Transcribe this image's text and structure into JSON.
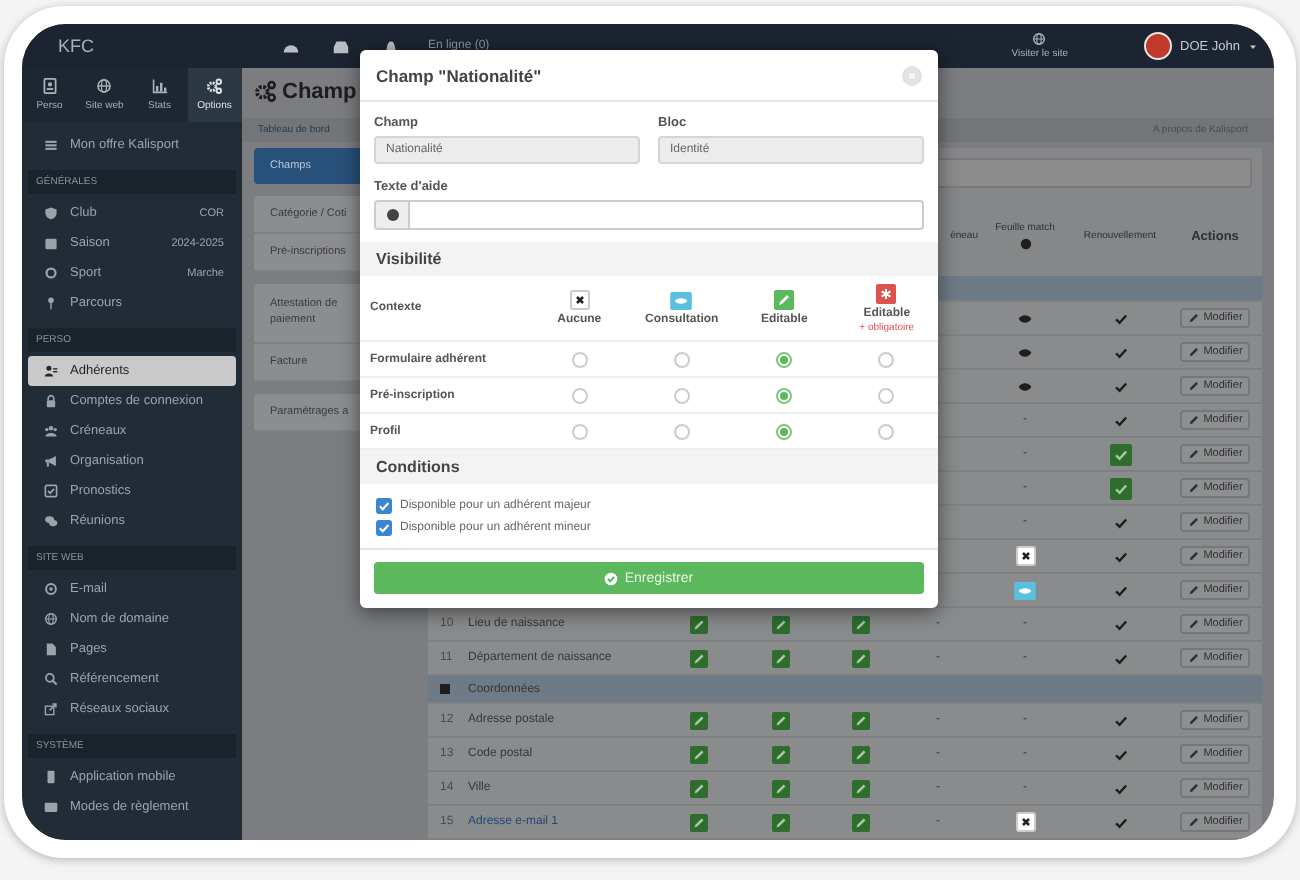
{
  "topbar": {
    "brand": "KFC",
    "status": "En ligne (0)",
    "visit": "Visiter le site",
    "user": "DOE John"
  },
  "sidebar": {
    "tabs": [
      {
        "label": "Perso",
        "selected": false
      },
      {
        "label": "Site web",
        "selected": false
      },
      {
        "label": "Stats",
        "selected": false
      },
      {
        "label": "Options",
        "selected": true
      }
    ],
    "items": [
      {
        "label": "Mon offre Kalisport",
        "selected": false
      }
    ],
    "sections": [
      {
        "title": "GÉNÉRALES",
        "items": [
          {
            "label": "Club",
            "value": "COR",
            "selected": false
          },
          {
            "label": "Saison",
            "value": "2024-2025",
            "selected": false
          },
          {
            "label": "Sport",
            "value": "Marche",
            "selected": false
          },
          {
            "label": "Parcours",
            "selected": false
          }
        ]
      },
      {
        "title": "PERSO",
        "items": [
          {
            "label": "Adhérents",
            "selected": true
          },
          {
            "label": "Comptes de connexion",
            "selected": false
          },
          {
            "label": "Créneaux",
            "selected": false
          },
          {
            "label": "Organisation",
            "selected": false
          },
          {
            "label": "Pronostics",
            "selected": false
          },
          {
            "label": "Réunions",
            "selected": false
          }
        ]
      },
      {
        "title": "SITE WEB",
        "items": [
          {
            "label": "E-mail",
            "selected": false
          },
          {
            "label": "Nom de domaine",
            "selected": false
          },
          {
            "label": "Pages",
            "selected": false
          },
          {
            "label": "Référencement",
            "selected": false
          },
          {
            "label": "Réseaux sociaux",
            "selected": false
          }
        ]
      },
      {
        "title": "SYSTÈME",
        "items": [
          {
            "label": "Application mobile",
            "selected": false
          },
          {
            "label": "Modes de règlement",
            "selected": false
          }
        ]
      }
    ]
  },
  "page": {
    "title": "Champ",
    "breadcrumb": "Tableau de bord",
    "about": "A propos de Kalisport"
  },
  "subnav": [
    {
      "items": [
        {
          "label": "Champs",
          "selected": true
        }
      ]
    },
    {
      "items": [
        {
          "label": "Catégorie / Coti",
          "selected": false
        },
        {
          "label": "Pré-inscriptions",
          "selected": false
        }
      ]
    },
    {
      "items": [
        {
          "label": "Attestation de paiement",
          "selected": false
        },
        {
          "label": "Facture",
          "selected": false
        }
      ]
    },
    {
      "items": [
        {
          "label": "Paramétrages a",
          "selected": false
        }
      ]
    }
  ],
  "table": {
    "columns": [
      {
        "label": "éneau",
        "help": false
      },
      {
        "label": "Feuille match",
        "help": true
      },
      {
        "label": "Renouvellement",
        "help": false
      },
      {
        "label": "Actions",
        "help": false
      }
    ],
    "rows": [
      {
        "kind": "section"
      },
      {
        "kind": "field",
        "feuille": {
          "kind": "eye"
        },
        "renouvellement": {
          "kind": "check"
        },
        "action": "Modifier"
      },
      {
        "kind": "field",
        "feuille": {
          "kind": "eye"
        },
        "renouvellement": {
          "kind": "check"
        },
        "action": "Modifier"
      },
      {
        "kind": "field",
        "feuille": {
          "kind": "eye"
        },
        "renouvellement": {
          "kind": "check"
        },
        "action": "Modifier"
      },
      {
        "kind": "field",
        "feuille": {
          "kind": "text",
          "text": "-"
        },
        "renouvellement": {
          "kind": "check"
        },
        "action": "Modifier"
      },
      {
        "kind": "field",
        "feuille": {
          "kind": "text",
          "text": "-"
        },
        "renouvellement": {
          "kind": "check-box"
        },
        "action": "Modifier"
      },
      {
        "kind": "field",
        "feuille": {
          "kind": "text",
          "text": "-"
        },
        "renouvellement": {
          "kind": "check-box"
        },
        "action": "Modifier"
      },
      {
        "kind": "field",
        "feuille": {
          "kind": "text",
          "text": "-"
        },
        "renouvellement": {
          "kind": "check"
        },
        "action": "Modifier"
      },
      {
        "kind": "field",
        "feuille": {
          "kind": "x-box"
        },
        "renouvellement": {
          "kind": "check"
        },
        "action": "Modifier"
      },
      {
        "kind": "field",
        "feuille": {
          "kind": "eye-box"
        },
        "renouvellement": {
          "kind": "check"
        },
        "action": "Modifier"
      },
      {
        "kind": "field",
        "number": "10",
        "name": "Lieu de naissance",
        "link": false,
        "access": [
          {
            "kind": "edit"
          },
          {
            "kind": "edit"
          },
          {
            "kind": "edit"
          }
        ],
        "col5": {
          "kind": "text",
          "text": "-"
        },
        "feuille": {
          "kind": "text",
          "text": "-"
        },
        "renouvellement": {
          "kind": "check"
        },
        "action": "Modifier"
      },
      {
        "kind": "field",
        "number": "11",
        "name": "Département de naissance",
        "link": false,
        "access": [
          {
            "kind": "edit"
          },
          {
            "kind": "edit"
          },
          {
            "kind": "edit"
          }
        ],
        "col5": {
          "kind": "text",
          "text": "-"
        },
        "feuille": {
          "kind": "text",
          "text": "-"
        },
        "renouvellement": {
          "kind": "check"
        },
        "action": "Modifier"
      },
      {
        "kind": "section",
        "label": "Coordonnées"
      },
      {
        "kind": "field",
        "number": "12",
        "name": "Adresse postale",
        "link": false,
        "access": [
          {
            "kind": "edit"
          },
          {
            "kind": "edit"
          },
          {
            "kind": "edit"
          }
        ],
        "col5": {
          "kind": "text",
          "text": "-"
        },
        "feuille": {
          "kind": "text",
          "text": "-"
        },
        "renouvellement": {
          "kind": "check"
        },
        "action": "Modifier"
      },
      {
        "kind": "field",
        "number": "13",
        "name": "Code postal",
        "link": false,
        "access": [
          {
            "kind": "edit"
          },
          {
            "kind": "edit"
          },
          {
            "kind": "edit"
          }
        ],
        "col5": {
          "kind": "text",
          "text": "-"
        },
        "feuille": {
          "kind": "text",
          "text": "-"
        },
        "renouvellement": {
          "kind": "check"
        },
        "action": "Modifier"
      },
      {
        "kind": "field",
        "number": "14",
        "name": "Ville",
        "link": false,
        "access": [
          {
            "kind": "edit"
          },
          {
            "kind": "edit"
          },
          {
            "kind": "edit"
          }
        ],
        "col5": {
          "kind": "text",
          "text": "-"
        },
        "feuille": {
          "kind": "text",
          "text": "-"
        },
        "renouvellement": {
          "kind": "check"
        },
        "action": "Modifier"
      },
      {
        "kind": "field",
        "number": "15",
        "name": "Adresse e-mail 1",
        "link": true,
        "access": [
          {
            "kind": "edit"
          },
          {
            "kind": "edit"
          },
          {
            "kind": "edit"
          }
        ],
        "col5": {
          "kind": "text",
          "text": "-"
        },
        "feuille": {
          "kind": "x-box"
        },
        "renouvellement": {
          "kind": "check"
        },
        "action": "Modifier"
      }
    ]
  },
  "modal": {
    "title": "Champ \"Nationalité\"",
    "fields": [
      {
        "label": "Champ",
        "value": "Nationalité"
      },
      {
        "label": "Bloc",
        "value": "Identité"
      }
    ],
    "help": {
      "label": "Texte d'aide"
    },
    "visibility": {
      "title": "Visibilité",
      "context_label": "Contexte",
      "options": [
        {
          "kind": "none",
          "label": "Aucune"
        },
        {
          "kind": "view",
          "label": "Consultation"
        },
        {
          "kind": "edit",
          "label": "Editable"
        },
        {
          "kind": "required",
          "label": "Editable",
          "note": "+ obligatoire"
        }
      ],
      "rows": [
        {
          "label": "Formulaire adhérent",
          "options": [
            {
              "selected": false
            },
            {
              "selected": false
            },
            {
              "selected": true
            },
            {
              "selected": false
            }
          ]
        },
        {
          "label": "Pré-inscription",
          "options": [
            {
              "selected": false
            },
            {
              "selected": false
            },
            {
              "selected": true
            },
            {
              "selected": false
            }
          ]
        },
        {
          "label": "Profil",
          "options": [
            {
              "selected": false
            },
            {
              "selected": false
            },
            {
              "selected": true
            },
            {
              "selected": false
            }
          ]
        }
      ]
    },
    "conditions": {
      "title": "Conditions",
      "items": [
        {
          "label": "Disponible pour un adhérent majeur",
          "checked": true
        },
        {
          "label": "Disponible pour un adhérent mineur",
          "checked": true
        }
      ]
    },
    "submit": "Enregistrer"
  }
}
